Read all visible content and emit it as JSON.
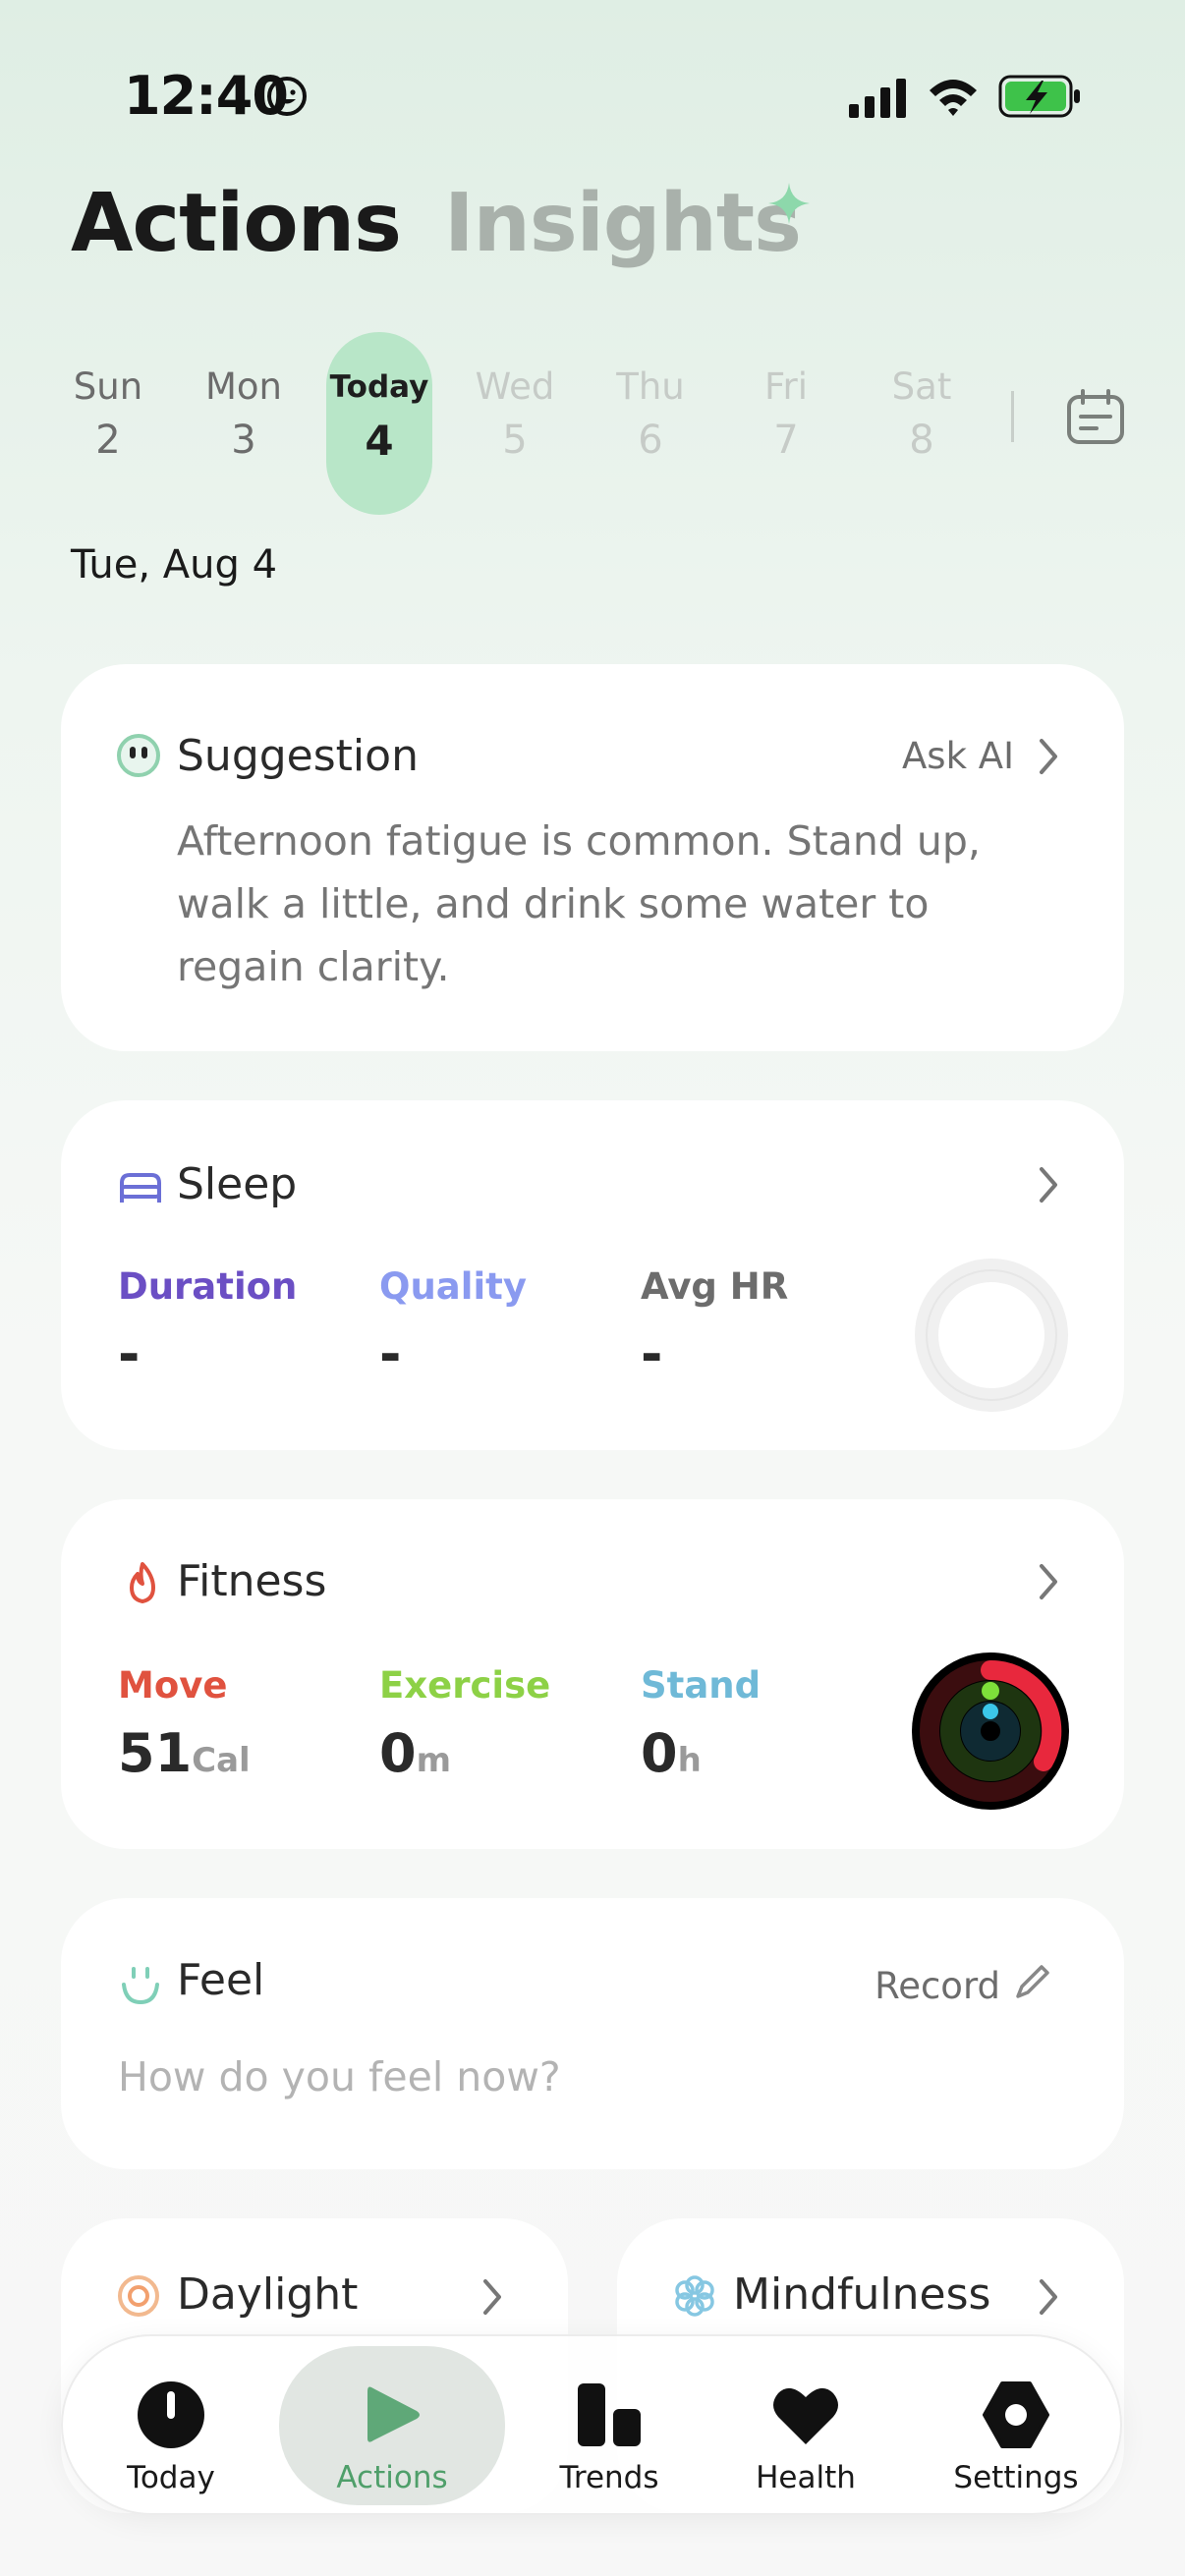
{
  "status_bar": {
    "time": "12:40"
  },
  "header": {
    "tab_actions": "Actions",
    "tab_insights": "Insights"
  },
  "week": [
    {
      "name": "Sun",
      "num": "2",
      "state": "past"
    },
    {
      "name": "Mon",
      "num": "3",
      "state": "past"
    },
    {
      "name": "Today",
      "num": "4",
      "state": "today"
    },
    {
      "name": "Wed",
      "num": "5",
      "state": "future"
    },
    {
      "name": "Thu",
      "num": "6",
      "state": "future"
    },
    {
      "name": "Fri",
      "num": "7",
      "state": "future"
    },
    {
      "name": "Sat",
      "num": "8",
      "state": "future"
    }
  ],
  "date_label": "Tue, Aug 4",
  "suggestion": {
    "title": "Suggestion",
    "ask_ai": "Ask AI",
    "body": "Afternoon fatigue is common. Stand up, walk a little, and drink some water to regain clarity."
  },
  "sleep": {
    "title": "Sleep",
    "metrics": [
      {
        "label": "Duration",
        "value": "-",
        "color": "#6b4fc4"
      },
      {
        "label": "Quality",
        "value": "-",
        "color": "#8a9af0"
      },
      {
        "label": "Avg HR",
        "value": "-",
        "color": "#6c6c6c"
      }
    ]
  },
  "fitness": {
    "title": "Fitness",
    "metrics": [
      {
        "label": "Move",
        "value": "51",
        "unit": "Cal",
        "color": "#e0523f"
      },
      {
        "label": "Exercise",
        "value": "0",
        "unit": "m",
        "color": "#8dd146"
      },
      {
        "label": "Stand",
        "value": "0",
        "unit": "h",
        "color": "#6fb9d7"
      }
    ]
  },
  "feel": {
    "title": "Feel",
    "record": "Record",
    "placeholder": "How do you feel now?"
  },
  "daylight": {
    "title": "Daylight"
  },
  "mindfulness": {
    "title": "Mindfulness"
  },
  "nav": {
    "today": "Today",
    "actions": "Actions",
    "trends": "Trends",
    "health": "Health",
    "settings": "Settings"
  },
  "colors": {
    "accent": "#4f9f6a",
    "today_pill": "#b8e6c8"
  }
}
